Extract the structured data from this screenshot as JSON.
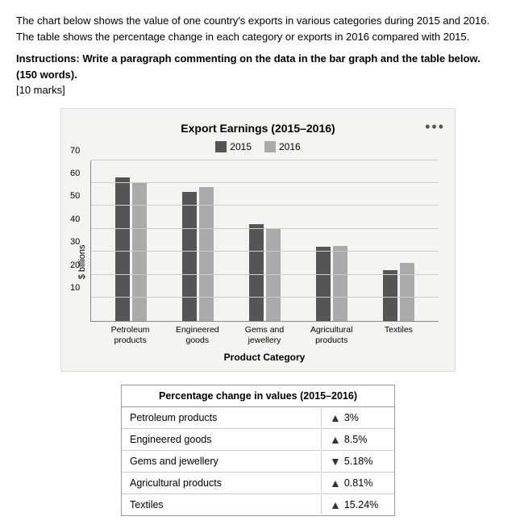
{
  "intro": {
    "text1": "The chart below shows the value of one country's exports in various categories during 2015 and 2016. The table shows the percentage change in each category or exports in 2016 compared with 2015.",
    "instructions": "Instructions: Write a paragraph commenting on the data in the bar graph and the table below. (150 words).",
    "marks": "[10 marks]"
  },
  "chart": {
    "title": "Export Earnings (2015–2016)",
    "yAxisLabel": "$ billions",
    "xAxisTitle": "Product Category",
    "legend": {
      "label2015": "2015",
      "label2016": "2016"
    },
    "yTicks": [
      10,
      20,
      30,
      40,
      50,
      60,
      70
    ],
    "maxValue": 70,
    "categories": [
      {
        "name": "Petroleum\nproducts",
        "label_line1": "Petroleum",
        "label_line2": "products",
        "val2015": 62,
        "val2016": 60
      },
      {
        "name": "Engineered\ngoods",
        "label_line1": "Engineered",
        "label_line2": "goods",
        "val2015": 56,
        "val2016": 58
      },
      {
        "name": "Gems and\njewellery",
        "label_line1": "Gems and",
        "label_line2": "jewellery",
        "val2015": 42,
        "val2016": 40
      },
      {
        "name": "Agricultural\nproducts",
        "label_line1": "Agricultural",
        "label_line2": "products",
        "val2015": 32,
        "val2016": 32.5
      },
      {
        "name": "Textiles",
        "label_line1": "Textiles",
        "label_line2": "",
        "val2015": 22,
        "val2016": 25
      }
    ]
  },
  "table": {
    "header": "Percentage change in values (2015–2016)",
    "rows": [
      {
        "category": "Petroleum products",
        "direction": "up",
        "value": "3%"
      },
      {
        "category": "Engineered goods",
        "direction": "up",
        "value": "8.5%"
      },
      {
        "category": "Gems and jewellery",
        "direction": "down",
        "value": "5.18%"
      },
      {
        "category": "Agricultural products",
        "direction": "up",
        "value": "0.81%"
      },
      {
        "category": "Textiles",
        "direction": "up",
        "value": "15.24%"
      }
    ]
  }
}
